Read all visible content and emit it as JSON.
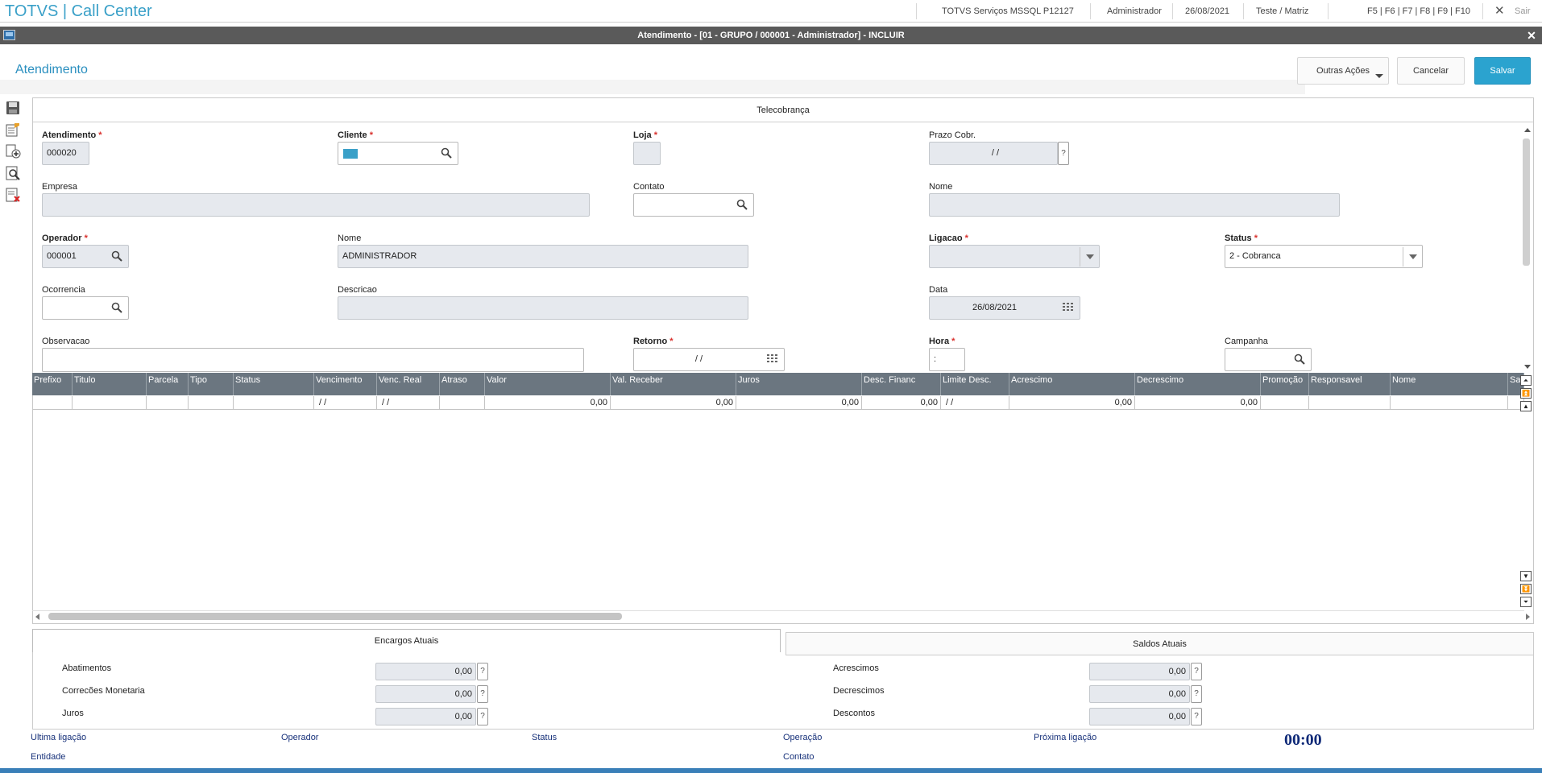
{
  "topbar": {
    "app_title": "TOTVS | Call Center",
    "env": "TOTVS Serviços MSSQL P12127",
    "user": "Administrador",
    "date": "26/08/2021",
    "branch": "Teste / Matriz",
    "shortcuts": "F5 | F6 | F7 | F8 | F9 | F10",
    "exit_label": "Sair"
  },
  "window": {
    "title": "Atendimento - [01 - GRUPO / 000001 - Administrador] - INCLUIR"
  },
  "page": {
    "title": "Atendimento",
    "btn_other": "Outras Ações",
    "btn_cancel": "Cancelar",
    "btn_save": "Salvar"
  },
  "tab": {
    "title": "Telecobrança"
  },
  "form": {
    "required_mark": "*",
    "atendimento": {
      "label": "Atendimento",
      "value": "000020"
    },
    "cliente": {
      "label": "Cliente",
      "value": ""
    },
    "loja": {
      "label": "Loja",
      "value": ""
    },
    "prazo": {
      "label": "Prazo Cobr.",
      "value": "/ /",
      "help": "?"
    },
    "empresa": {
      "label": "Empresa",
      "value": ""
    },
    "contato": {
      "label": "Contato",
      "value": ""
    },
    "nome1": {
      "label": "Nome",
      "value": ""
    },
    "operador": {
      "label": "Operador",
      "value": "000001"
    },
    "nome2": {
      "label": "Nome",
      "value": "ADMINISTRADOR"
    },
    "ligacao": {
      "label": "Ligacao",
      "value": ""
    },
    "status": {
      "label": "Status",
      "value": "2 - Cobranca"
    },
    "ocorrencia": {
      "label": "Ocorrencia",
      "value": ""
    },
    "descricao": {
      "label": "Descricao",
      "value": ""
    },
    "data": {
      "label": "Data",
      "value": "26/08/2021"
    },
    "observacao": {
      "label": "Observacao",
      "value": ""
    },
    "retorno": {
      "label": "Retorno",
      "value": "/ /"
    },
    "hora": {
      "label": "Hora",
      "value": ":"
    },
    "campanha": {
      "label": "Campanha",
      "value": ""
    }
  },
  "grid": {
    "headers": [
      "Prefixo",
      "Titulo",
      "Parcela",
      "Tipo",
      "Status",
      "Vencimento",
      "Venc. Real",
      "Atraso",
      "Valor",
      "Val. Receber",
      "Juros",
      "Desc. Financ",
      "Limite Desc.",
      "Acrescimo",
      "Decrescimo",
      "Promoção",
      "Responsavel",
      "Nome",
      "Sa"
    ],
    "row": [
      "",
      "",
      "",
      "",
      "",
      "/ /",
      "/ /",
      "",
      "0,00",
      "0,00",
      "0,00",
      "0,00",
      "/ /",
      "0,00",
      "0,00",
      "",
      "",
      "",
      ""
    ]
  },
  "encargos": {
    "tab": "Encargos Atuais",
    "abatimentos": {
      "label": "Abatimentos",
      "value": "0,00"
    },
    "correcoes": {
      "label": "Correcões Monetaria",
      "value": "0,00"
    },
    "juros": {
      "label": "Juros",
      "value": "0,00"
    }
  },
  "saldos": {
    "tab": "Saldos Atuais",
    "acrescimos": {
      "label": "Acrescimos",
      "value": "0,00"
    },
    "decrescimos": {
      "label": "Decrescimos",
      "value": "0,00"
    },
    "descontos": {
      "label": "Descontos",
      "value": "0,00"
    }
  },
  "help_mark": "?",
  "statusbar": {
    "ultima_ligacao": "Ultima ligação",
    "operador": "Operador",
    "status": "Status",
    "operacao": "Operação",
    "proxima_ligacao": "Próxima ligação",
    "entidade": "Entidade",
    "contato": "Contato",
    "clock": "00:00"
  },
  "colors": {
    "accent": "#2ba3cf",
    "title_blue": "#3aa0c8",
    "grid_header": "#6b7680",
    "status_text": "#17317a"
  }
}
